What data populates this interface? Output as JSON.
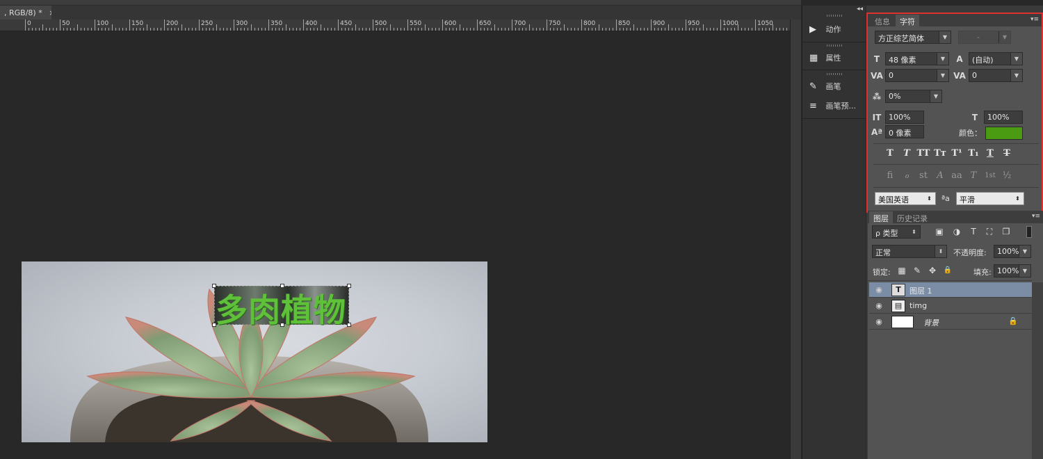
{
  "document": {
    "tab_title": ", RGB/8) *",
    "close_glyph": "×"
  },
  "ruler": {
    "labels": [
      "0",
      "50",
      "100",
      "150",
      "200",
      "250",
      "300",
      "350",
      "400",
      "450",
      "500",
      "550",
      "600",
      "650",
      "700",
      "750",
      "800",
      "850",
      "900",
      "950",
      "1000",
      "1050"
    ]
  },
  "canvas": {
    "art_text": "多肉植物",
    "text_color": "#5fc03a"
  },
  "dock": {
    "collapse_glyph": "◂◂",
    "items": [
      {
        "label": "动作",
        "icon": "play-icon",
        "glyph": "▶"
      },
      {
        "label": "属性",
        "icon": "properties-icon",
        "glyph": "▦"
      },
      {
        "label": "画笔",
        "icon": "brush-icon",
        "glyph": "✎"
      },
      {
        "label": "画笔预...",
        "icon": "brush-presets-icon",
        "glyph": "≡"
      }
    ]
  },
  "character_panel": {
    "tabs": [
      "信息",
      "字符"
    ],
    "active_tab": "字符",
    "menu_glyph": "▾≡",
    "font_family": "方正综艺简体",
    "font_style": "-",
    "font_size": "48 像素",
    "leading": "(自动)",
    "kerning": "0",
    "tracking": "0",
    "tsume": "0%",
    "vertical_scale": "100%",
    "horizontal_scale": "100%",
    "baseline_shift": "0 像素",
    "color_label": "颜色：",
    "color": "#4a9a12",
    "style_buttons": [
      "T",
      "T",
      "TT",
      "Tт",
      "T¹",
      "T₁",
      "T",
      "T"
    ],
    "opentype_buttons": [
      "ﬁ",
      "ℴ",
      "st",
      "A",
      "aa",
      "T",
      "1st",
      "½"
    ],
    "language": "美国英语",
    "aa_glyph": "ªa",
    "antialias": "平滑"
  },
  "layers_panel": {
    "tabs": [
      "图层",
      "历史记录"
    ],
    "active_tab": "图层",
    "menu_glyph": "▾≡",
    "filter_label": "ρ 类型",
    "blend_mode": "正常",
    "opacity_label": "不透明度:",
    "opacity_value": "100%",
    "lock_label": "锁定:",
    "fill_label": "填充:",
    "fill_value": "100%",
    "filter_icons": [
      "▣",
      "◑",
      "T",
      "⛶",
      "❐"
    ],
    "lock_icons": [
      "▦",
      "✎",
      "✥",
      "🔒"
    ],
    "layers": [
      {
        "name": "图层 1",
        "type": "text",
        "thumb": "T",
        "selected": true
      },
      {
        "name": "timg",
        "type": "smart",
        "thumb": "▤",
        "selected": false
      },
      {
        "name": "背景",
        "type": "background",
        "thumb": "",
        "selected": false,
        "locked": true
      }
    ],
    "eye_glyph": "◉",
    "lock_glyph": "🔒"
  }
}
